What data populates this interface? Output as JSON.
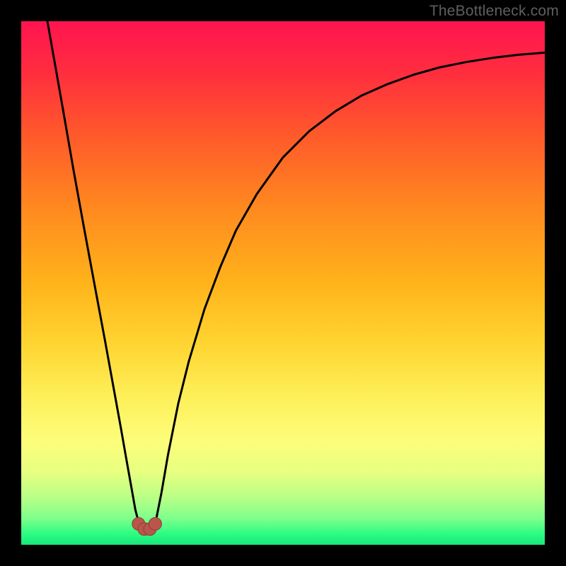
{
  "watermark": "TheBottleneck.com",
  "colors": {
    "background": "#000000",
    "curve": "#000000",
    "dot_fill": "#b9564c",
    "dot_stroke": "#8d3e35"
  },
  "chart_data": {
    "type": "line",
    "title": "",
    "xlabel": "",
    "ylabel": "",
    "xlim": [
      0,
      1
    ],
    "ylim": [
      0,
      1
    ],
    "grid": false,
    "legend": false,
    "series": [
      {
        "name": "curve",
        "x": [
          0.05,
          0.065,
          0.08,
          0.1,
          0.12,
          0.14,
          0.16,
          0.18,
          0.19,
          0.2,
          0.21,
          0.218,
          0.225,
          0.235,
          0.245,
          0.256,
          0.26,
          0.268,
          0.28,
          0.3,
          0.32,
          0.35,
          0.38,
          0.41,
          0.45,
          0.5,
          0.55,
          0.6,
          0.65,
          0.7,
          0.75,
          0.8,
          0.85,
          0.9,
          0.95,
          1.0
        ],
        "y": [
          1.0,
          0.915,
          0.83,
          0.715,
          0.605,
          0.497,
          0.39,
          0.28,
          0.225,
          0.168,
          0.112,
          0.067,
          0.04,
          0.03,
          0.03,
          0.04,
          0.06,
          0.1,
          0.17,
          0.27,
          0.35,
          0.45,
          0.53,
          0.6,
          0.67,
          0.74,
          0.79,
          0.828,
          0.858,
          0.88,
          0.898,
          0.912,
          0.922,
          0.93,
          0.936,
          0.94
        ]
      }
    ],
    "annotations": {
      "dots": [
        {
          "x": 0.224,
          "y": 0.04
        },
        {
          "x": 0.235,
          "y": 0.03
        },
        {
          "x": 0.246,
          "y": 0.03
        },
        {
          "x": 0.256,
          "y": 0.04
        }
      ]
    }
  }
}
